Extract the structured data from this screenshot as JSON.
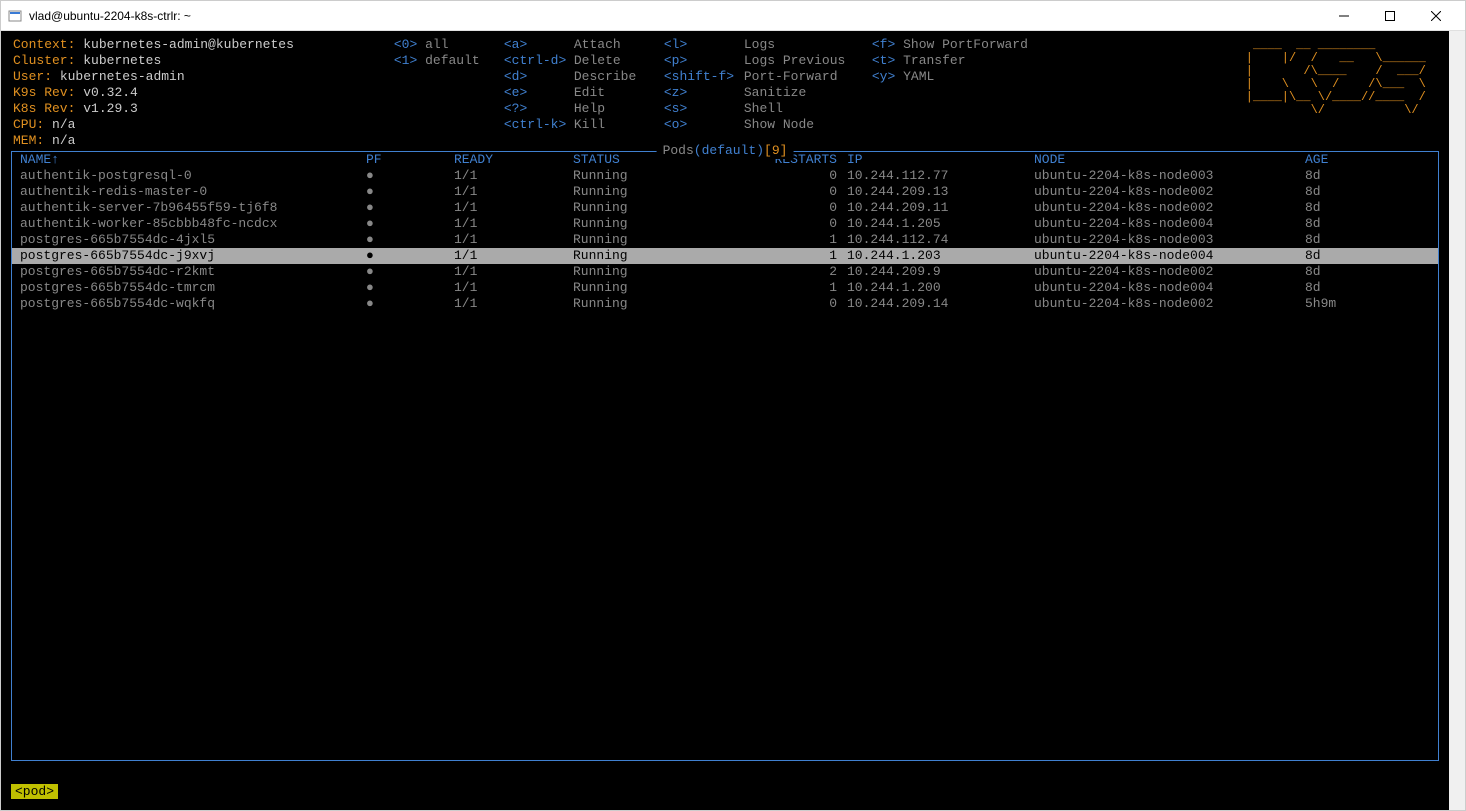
{
  "window": {
    "title": "vlad@ubuntu-2204-k8s-ctrlr: ~"
  },
  "info": {
    "context_label": "Context:",
    "context_value": "kubernetes-admin@kubernetes",
    "cluster_label": "Cluster:",
    "cluster_value": "kubernetes",
    "user_label": "User:",
    "user_value": "kubernetes-admin",
    "k9s_label": "K9s Rev:",
    "k9s_value": "v0.32.4",
    "k8s_label": "K8s Rev:",
    "k8s_value": "v1.29.3",
    "cpu_label": "CPU:",
    "cpu_value": "n/a",
    "mem_label": "MEM:",
    "mem_value": "n/a"
  },
  "cmds": {
    "col1": [
      {
        "k": "<0>",
        "v": "all"
      },
      {
        "k": "<1>",
        "v": "default"
      }
    ],
    "col2": [
      {
        "k": "<a>",
        "v": ""
      },
      {
        "k": "<ctrl-d>",
        "v": ""
      },
      {
        "k": "<d>",
        "v": ""
      },
      {
        "k": "<e>",
        "v": ""
      },
      {
        "k": "<?>",
        "v": ""
      },
      {
        "k": "<ctrl-k>",
        "v": ""
      }
    ],
    "col2b": [
      "Attach",
      "Delete",
      "Describe",
      "Edit",
      "Help",
      "Kill"
    ],
    "col3": [
      {
        "k": "<l>",
        "v": ""
      },
      {
        "k": "<p>",
        "v": ""
      },
      {
        "k": "<shift-f>",
        "v": ""
      },
      {
        "k": "<z>",
        "v": ""
      },
      {
        "k": "<s>",
        "v": ""
      },
      {
        "k": "<o>",
        "v": ""
      }
    ],
    "col3b": [
      "Logs",
      "Logs Previous",
      "Port-Forward",
      "Sanitize",
      "Shell",
      "Show Node"
    ],
    "col4": [
      {
        "k": "<f>",
        "v": "Show PortForward"
      },
      {
        "k": "<t>",
        "v": "Transfer"
      },
      {
        "k": "<y>",
        "v": "YAML"
      }
    ]
  },
  "table": {
    "title_pods": "Pods",
    "title_ns": "(default)",
    "title_count": "[9]",
    "headers": {
      "name": "NAME↑",
      "pf": "PF",
      "ready": "READY",
      "status": "STATUS",
      "restarts": "RESTARTS",
      "ip": "IP",
      "node": "NODE",
      "age": "AGE"
    },
    "rows": [
      {
        "name": "authentik-postgresql-0",
        "pf": "●",
        "ready": "1/1",
        "status": "Running",
        "restarts": "0",
        "ip": "10.244.112.77",
        "node": "ubuntu-2204-k8s-node003",
        "age": "8d",
        "selected": false
      },
      {
        "name": "authentik-redis-master-0",
        "pf": "●",
        "ready": "1/1",
        "status": "Running",
        "restarts": "0",
        "ip": "10.244.209.13",
        "node": "ubuntu-2204-k8s-node002",
        "age": "8d",
        "selected": false
      },
      {
        "name": "authentik-server-7b96455f59-tj6f8",
        "pf": "●",
        "ready": "1/1",
        "status": "Running",
        "restarts": "0",
        "ip": "10.244.209.11",
        "node": "ubuntu-2204-k8s-node002",
        "age": "8d",
        "selected": false
      },
      {
        "name": "authentik-worker-85cbbb48fc-ncdcx",
        "pf": "●",
        "ready": "1/1",
        "status": "Running",
        "restarts": "0",
        "ip": "10.244.1.205",
        "node": "ubuntu-2204-k8s-node004",
        "age": "8d",
        "selected": false
      },
      {
        "name": "postgres-665b7554dc-4jxl5",
        "pf": "●",
        "ready": "1/1",
        "status": "Running",
        "restarts": "1",
        "ip": "10.244.112.74",
        "node": "ubuntu-2204-k8s-node003",
        "age": "8d",
        "selected": false
      },
      {
        "name": "postgres-665b7554dc-j9xvj",
        "pf": "●",
        "ready": "1/1",
        "status": "Running",
        "restarts": "1",
        "ip": "10.244.1.203",
        "node": "ubuntu-2204-k8s-node004",
        "age": "8d",
        "selected": true
      },
      {
        "name": "postgres-665b7554dc-r2kmt",
        "pf": "●",
        "ready": "1/1",
        "status": "Running",
        "restarts": "2",
        "ip": "10.244.209.9",
        "node": "ubuntu-2204-k8s-node002",
        "age": "8d",
        "selected": false
      },
      {
        "name": "postgres-665b7554dc-tmrcm",
        "pf": "●",
        "ready": "1/1",
        "status": "Running",
        "restarts": "1",
        "ip": "10.244.1.200",
        "node": "ubuntu-2204-k8s-node004",
        "age": "8d",
        "selected": false
      },
      {
        "name": "postgres-665b7554dc-wqkfq",
        "pf": "●",
        "ready": "1/1",
        "status": "Running",
        "restarts": "0",
        "ip": "10.244.209.14",
        "node": "ubuntu-2204-k8s-node002",
        "age": "5h9m",
        "selected": false
      }
    ]
  },
  "footer": {
    "crumb": "<pod>"
  },
  "logo": " ____  __ ________        \n|    |/  /   __   \\______ \n|       /\\____    /  ___/ \n|    \\   \\  /    /\\___  \\ \n|____|\\__ \\/____//____  / \n         \\/           \\/  "
}
